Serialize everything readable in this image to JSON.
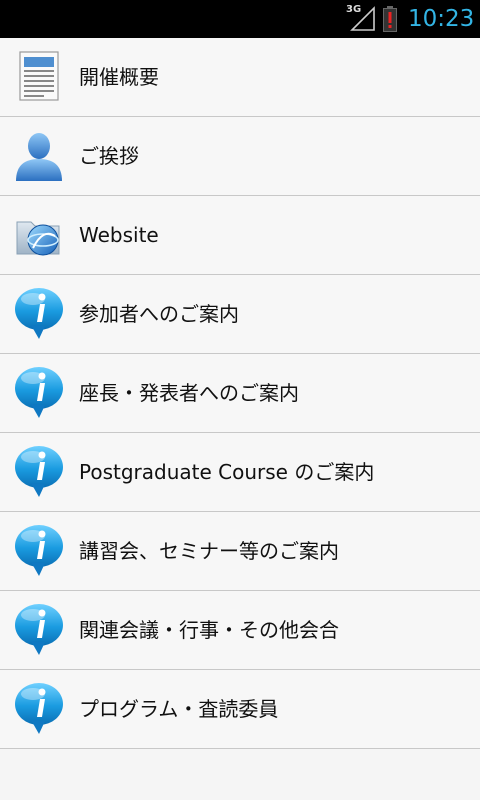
{
  "status_bar": {
    "network_label": "3G",
    "time": "10:23",
    "icons": [
      "signal-icon",
      "battery-alert-icon"
    ],
    "time_color": "#33b5e5"
  },
  "menu": {
    "items": [
      {
        "label": "開催概要",
        "icon": "document-icon"
      },
      {
        "label": "ご挨拶",
        "icon": "person-icon"
      },
      {
        "label": "Website",
        "icon": "globe-folder-icon"
      },
      {
        "label": "参加者へのご案内",
        "icon": "info-bubble-icon"
      },
      {
        "label": "座長・発表者へのご案内",
        "icon": "info-bubble-icon"
      },
      {
        "label": "Postgraduate Course のご案内",
        "icon": "info-bubble-icon"
      },
      {
        "label": "講習会、セミナー等のご案内",
        "icon": "info-bubble-icon"
      },
      {
        "label": "関連会議・行事・その他会合",
        "icon": "info-bubble-icon"
      },
      {
        "label": "プログラム・査読委員",
        "icon": "info-bubble-icon"
      }
    ]
  },
  "colors": {
    "info_blue": "#1a9be0",
    "list_background": "#f7f7f7",
    "divider": "#c8c8c8"
  }
}
